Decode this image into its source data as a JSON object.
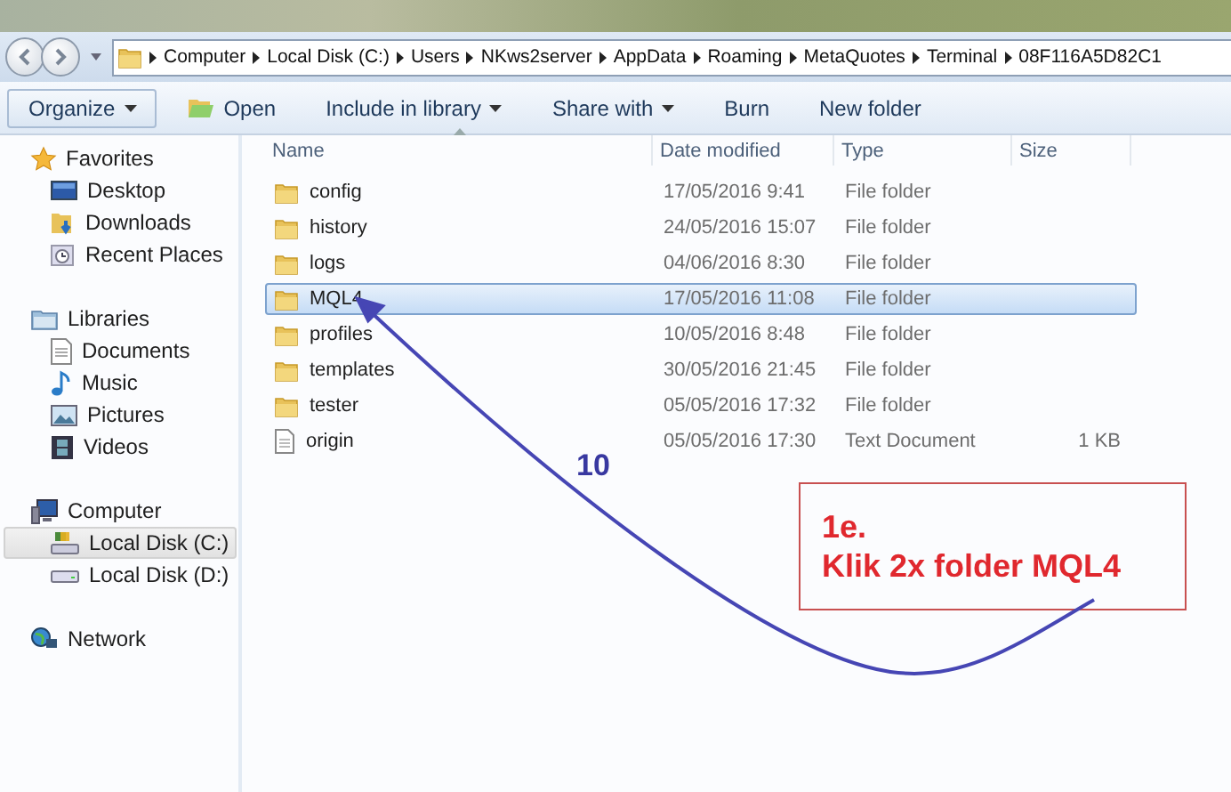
{
  "address_bar": {
    "crumbs": [
      "Computer",
      "Local Disk (C:)",
      "Users",
      "NKws2server",
      "AppData",
      "Roaming",
      "MetaQuotes",
      "Terminal",
      "08F116A5D82C1"
    ]
  },
  "toolbar": {
    "buttons": [
      {
        "label": "Organize",
        "kind": "menu"
      },
      {
        "label": "Open",
        "kind": "open"
      },
      {
        "label": "Include in library",
        "kind": "menu"
      },
      {
        "label": "Share with",
        "kind": "menu"
      },
      {
        "label": "Burn",
        "kind": "plain"
      },
      {
        "label": "New folder",
        "kind": "plain"
      }
    ]
  },
  "sidebar": {
    "groups": [
      {
        "label": "Favorites",
        "kind": "favorites",
        "children": [
          {
            "label": "Desktop",
            "kind": "desktop",
            "selected": false
          },
          {
            "label": "Downloads",
            "kind": "downloads",
            "selected": false
          },
          {
            "label": "Recent Places",
            "kind": "recent",
            "selected": false
          }
        ]
      },
      {
        "label": "Libraries",
        "kind": "libraries",
        "children": [
          {
            "label": "Documents",
            "kind": "documents",
            "selected": false
          },
          {
            "label": "Music",
            "kind": "music",
            "selected": false
          },
          {
            "label": "Pictures",
            "kind": "pictures",
            "selected": false
          },
          {
            "label": "Videos",
            "kind": "videos",
            "selected": false
          }
        ]
      },
      {
        "label": "Computer",
        "kind": "computer",
        "children": [
          {
            "label": "Local Disk (C:)",
            "kind": "drive-c",
            "selected": true
          },
          {
            "label": "Local Disk (D:)",
            "kind": "drive",
            "selected": false
          }
        ]
      },
      {
        "label": "Network",
        "kind": "network"
      }
    ]
  },
  "file_list": {
    "columns": [
      {
        "label": "Name",
        "sorted": true
      },
      {
        "label": "Date modified",
        "sorted": false
      },
      {
        "label": "Type",
        "sorted": false
      },
      {
        "label": "Size",
        "sorted": false
      }
    ],
    "rows": [
      {
        "name": "config",
        "date": "17/05/2016 9:41",
        "type": "File folder",
        "kind": "folder",
        "selected": false
      },
      {
        "name": "history",
        "date": "24/05/2016 15:07",
        "type": "File folder",
        "kind": "folder",
        "selected": false
      },
      {
        "name": "logs",
        "date": "04/06/2016 8:30",
        "type": "File folder",
        "kind": "folder",
        "selected": false
      },
      {
        "name": "MQL4",
        "date": "17/05/2016 11:08",
        "type": "File folder",
        "kind": "folder",
        "selected": true
      },
      {
        "name": "profiles",
        "date": "10/05/2016 8:48",
        "type": "File folder",
        "kind": "folder",
        "selected": false
      },
      {
        "name": "templates",
        "date": "30/05/2016 21:45",
        "type": "File folder",
        "kind": "folder",
        "selected": false
      },
      {
        "name": "tester",
        "date": "05/05/2016 17:32",
        "type": "File folder",
        "kind": "folder",
        "selected": false
      },
      {
        "name": "origin",
        "date": "05/05/2016 17:30",
        "type": "Text Document",
        "size": "1 KB",
        "kind": "file",
        "selected": false
      }
    ]
  },
  "annotation": {
    "step_number": "10",
    "callout": [
      "1e.",
      "Klik 2x folder MQL4"
    ]
  }
}
